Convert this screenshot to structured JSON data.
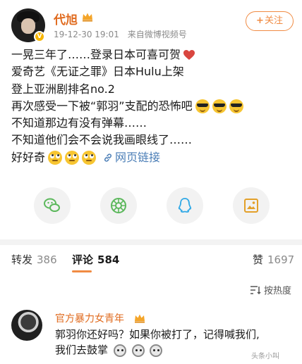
{
  "post": {
    "username": "代旭",
    "date": "19-12-30 19:01",
    "source": "来自微博视频号",
    "follow_label": "关注",
    "lines": [
      "一晃三年了……登录日本可喜可贺",
      "爱奇艺《无证之罪》日本Hulu上架",
      "登上亚洲剧排名no.2",
      "再次感受一下被“郭羽”支配的恐怖吧",
      "不知道那边有没有弹幕……",
      "不知道他们会不会说我画眼线了……",
      "好好奇"
    ],
    "web_link_label": "网页链接"
  },
  "share_icons": [
    "wechat-icon",
    "moments-icon",
    "qq-icon",
    "save-image-icon"
  ],
  "tabs": {
    "repost_label": "转发",
    "repost_count": "386",
    "comment_label": "评论",
    "comment_count": "584",
    "like_label": "赞",
    "like_count": "1697"
  },
  "sort": {
    "label": "按热度"
  },
  "comment": {
    "username": "官方暴力女青年",
    "text_line1": "郭羽你还好吗？如果你被打了，记得喊我们,",
    "text_line2": "我们去鼓掌"
  },
  "watermark": "头条小叫",
  "colors": {
    "accent": "#f08b43",
    "username": "#e06b1f",
    "link": "#4a7db6"
  }
}
